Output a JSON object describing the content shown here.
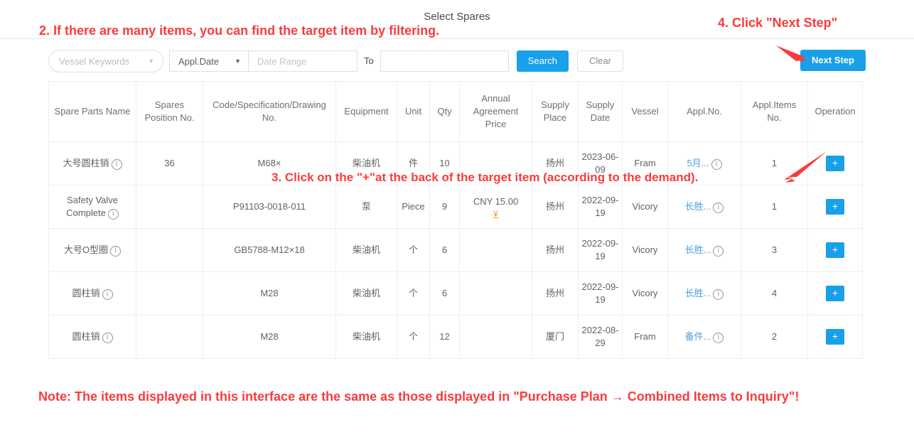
{
  "page": {
    "title": "Select Spares"
  },
  "toolbar": {
    "vessel_keywords_placeholder": "Vessel Keywords",
    "vessel_keywords_value": "Vessel Keywords",
    "date_type_value": "Appl.Date",
    "date_range_placeholder": "Date Range",
    "date_range_value": "Date Range",
    "to_label": "To",
    "date_range_end_value": "",
    "search_label": "Search",
    "clear_label": "Clear",
    "next_step_label": "Next Step",
    "caret_glyph": "▼",
    "accent_color": "#18a0e8"
  },
  "table": {
    "columns": [
      "Spare Parts Name",
      "Spares Position No.",
      "Code/Specification/Drawing No.",
      "Equipment",
      "Unit",
      "Qty",
      "Annual Agreement Price",
      "Supply Place",
      "Supply Date",
      "Vessel",
      "Appl.No.",
      "Appl.Items No.",
      "Operation"
    ],
    "rows": [
      {
        "name": "大号圆柱销",
        "position_no": "36",
        "code": "M68×",
        "equipment": "柴油机",
        "unit": "件",
        "qty": "10",
        "price": "",
        "has_price_icon": false,
        "supply_place": "扬州",
        "supply_date": "2023-06-09",
        "vessel": "Fram",
        "appl_no": "5月...",
        "appl_items_no": "1",
        "operation": "+"
      },
      {
        "name": "Safety Valve Complete",
        "position_no": "",
        "code": "P91103-0018-011",
        "equipment": "泵",
        "unit": "Piece",
        "qty": "9",
        "price": "CNY 15.00",
        "has_price_icon": true,
        "supply_place": "扬州",
        "supply_date": "2022-09-19",
        "vessel": "Vicory",
        "appl_no": "长胜...",
        "appl_items_no": "1",
        "operation": "+"
      },
      {
        "name": "大号O型圈",
        "position_no": "",
        "code": "GB5788-M12×18",
        "equipment": "柴油机",
        "unit": "个",
        "qty": "6",
        "price": "",
        "has_price_icon": false,
        "supply_place": "扬州",
        "supply_date": "2022-09-19",
        "vessel": "Vicory",
        "appl_no": "长胜...",
        "appl_items_no": "3",
        "operation": "+"
      },
      {
        "name": "圆柱销",
        "position_no": "",
        "code": "M28",
        "equipment": "柴油机",
        "unit": "个",
        "qty": "6",
        "price": "",
        "has_price_icon": false,
        "supply_place": "扬州",
        "supply_date": "2022-09-19",
        "vessel": "Vicory",
        "appl_no": "长胜...",
        "appl_items_no": "4",
        "operation": "+"
      },
      {
        "name": "圆柱销",
        "position_no": "",
        "code": "M28",
        "equipment": "柴油机",
        "unit": "个",
        "qty": "12",
        "price": "",
        "has_price_icon": false,
        "supply_place": "厦门",
        "supply_date": "2022-08-29",
        "vessel": "Fram",
        "appl_no": "备件...",
        "appl_items_no": "2",
        "operation": "+"
      }
    ],
    "info_icon_glyph": "i",
    "price_icon_glyph": "¥"
  },
  "annotations": {
    "step2": "2. If there are many items, you can find the target item by filtering.",
    "step3": "3. Click on the \"+\"at the back of the target item (according to the demand).",
    "step4": "4. Click \"Next Step\"",
    "note": "Note: The items displayed in this interface are the same as those displayed in \"Purchase Plan → Combined Items to Inquiry\"!",
    "color": "#fb3b3b"
  }
}
